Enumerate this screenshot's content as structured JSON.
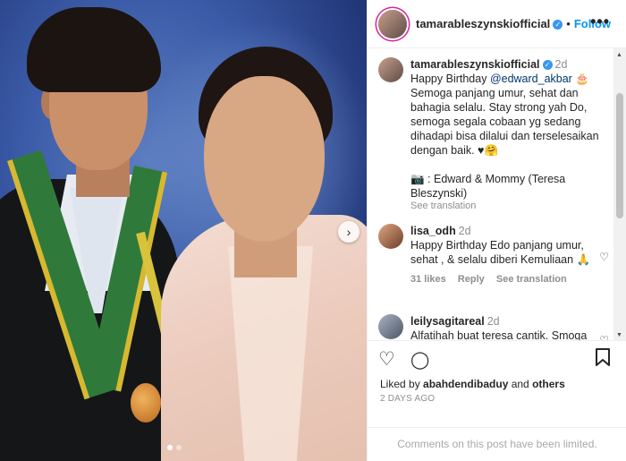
{
  "post": {
    "username": "tamarableszynskiofficial",
    "follow_label": "Follow",
    "separator": "•",
    "more_label": "•••",
    "caption": {
      "time": "2d",
      "line1_before": "Happy Birthday ",
      "mention": "@edward_akbar",
      "line1_after": " 🎂",
      "text": "Semoga panjang umur, sehat dan bahagia selalu. Stay strong yah Do, semoga segala cobaan yg sedang dihadapi bisa dilalui dan terselesaikan dengan baik. ♥🤗",
      "credit": "📷 : Edward & Mommy (Teresa Bleszynski)",
      "see_translation": "See translation"
    },
    "comments": [
      {
        "user": "lisa_odh",
        "time": "2d",
        "text": "Happy Birthday Edo panjang umur, sehat , & selalu diberi Kemuliaan 🙏",
        "likes": "31 likes",
        "reply": "Reply",
        "see_translation": "See translation"
      },
      {
        "user": "leilysagitareal",
        "time": "2d",
        "text": "Alfatihah buat teresa cantik. Smoga"
      }
    ],
    "liked_by_prefix": "Liked by ",
    "liked_by_user": "abahdendibaduy",
    "liked_by_and": " and ",
    "liked_by_others": "others",
    "posted_ago": "2 DAYS AGO",
    "comments_limited": "Comments on this post have been limited."
  },
  "icons": {
    "heart": "♡",
    "comment": "◯",
    "bookmark": "🔖",
    "next": "›",
    "verified": "✓"
  },
  "colors": {
    "link_blue": "#0095f6",
    "mention_blue": "#00376b",
    "muted": "#8e8e8e"
  }
}
